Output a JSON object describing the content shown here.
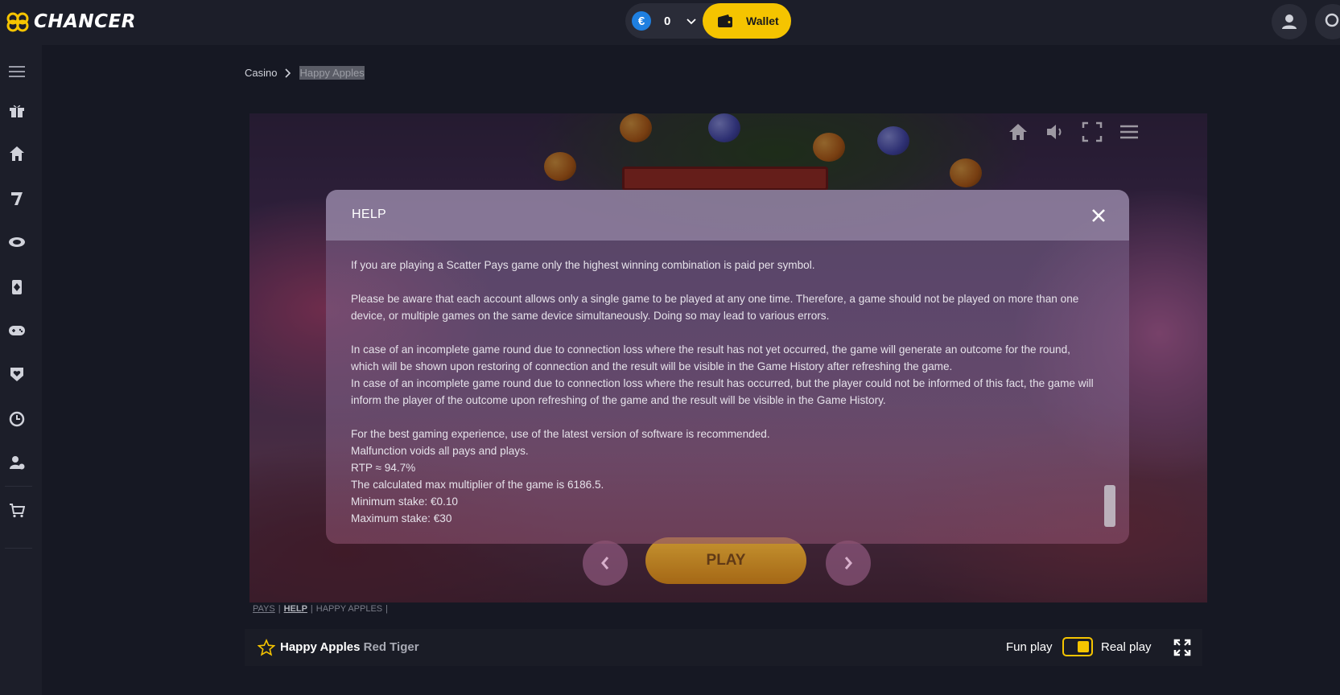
{
  "header": {
    "logo_text": "CHANCER",
    "currency_symbol": "€",
    "balance": "0",
    "wallet_label": "Wallet",
    "accent_color": "#f5c400",
    "currency_color": "#1e7fe0"
  },
  "sidebar": {
    "icons": [
      "menu-icon",
      "gift-icon",
      "home-icon",
      "slot-seven-icon",
      "casino-chip-icon",
      "poker-card-icon",
      "gamepad-icon",
      "heart-shield-icon",
      "live-clock-icon",
      "user-dollar-icon",
      "cart-icon"
    ]
  },
  "breadcrumb": {
    "root": "Casino",
    "current": "Happy Apples"
  },
  "game": {
    "play_label": "PLAY"
  },
  "help_modal": {
    "title": "HELP",
    "paragraphs": {
      "p1": "If you are playing a Scatter Pays game only the highest winning combination is paid per symbol.",
      "p2": "Please be aware that each account allows only a single game to be played at any one time. Therefore, a game should not be played on more than one device, or multiple games on the same device simultaneously. Doing so may lead to various errors.",
      "p3a": "In case of an incomplete game round due to connection loss where the result has not yet occurred, the game will generate an outcome for the round, which will be shown upon restoring of connection and the result will be visible in the Game History after refreshing the game.",
      "p3b": "In case of an incomplete game round due to connection loss where the result has occurred, but the player could not be informed of this fact, the game will inform the player of the outcome upon refreshing of the game and the result will be visible in the Game History.",
      "l1": "For the best gaming experience, use of the latest version of software is recommended.",
      "l2": "Malfunction voids all pays and plays.",
      "l3": "RTP ≈ 94.7%",
      "l4": "The calculated max multiplier of the game is 6186.5.",
      "l5": "Minimum stake: €0.10",
      "l6": "Maximum stake: €30"
    }
  },
  "game_tabs": {
    "pays": "PAYS",
    "sep1": "|",
    "help": "HELP",
    "sep2": "|",
    "name": "HAPPY APPLES",
    "sep3": "|"
  },
  "footer": {
    "game_title": "Happy Apples",
    "provider": "Red Tiger",
    "fun_play": "Fun play",
    "real_play": "Real play",
    "mode_real": true
  }
}
